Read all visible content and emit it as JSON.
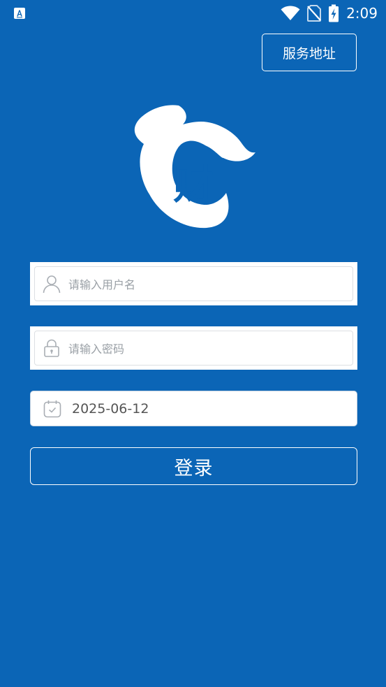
{
  "status_bar": {
    "time": "2:09",
    "left_icon": "a-letter-icon",
    "icons": [
      "wifi-icon",
      "no-sim-icon",
      "battery-charging-icon"
    ]
  },
  "header": {
    "service_button_label": "服务地址"
  },
  "logo": {
    "text": "财",
    "icon": "cai-logo-icon"
  },
  "form": {
    "username": {
      "placeholder": "请输入用户名",
      "icon": "user-icon"
    },
    "password": {
      "placeholder": "请输入密码",
      "icon": "lock-icon"
    },
    "date": {
      "value": "2025-06-12",
      "icon": "calendar-icon"
    },
    "login_button_label": "登录"
  },
  "colors": {
    "background": "#0b65b6",
    "field_background": "#ffffff",
    "placeholder": "#9aa0a6"
  }
}
